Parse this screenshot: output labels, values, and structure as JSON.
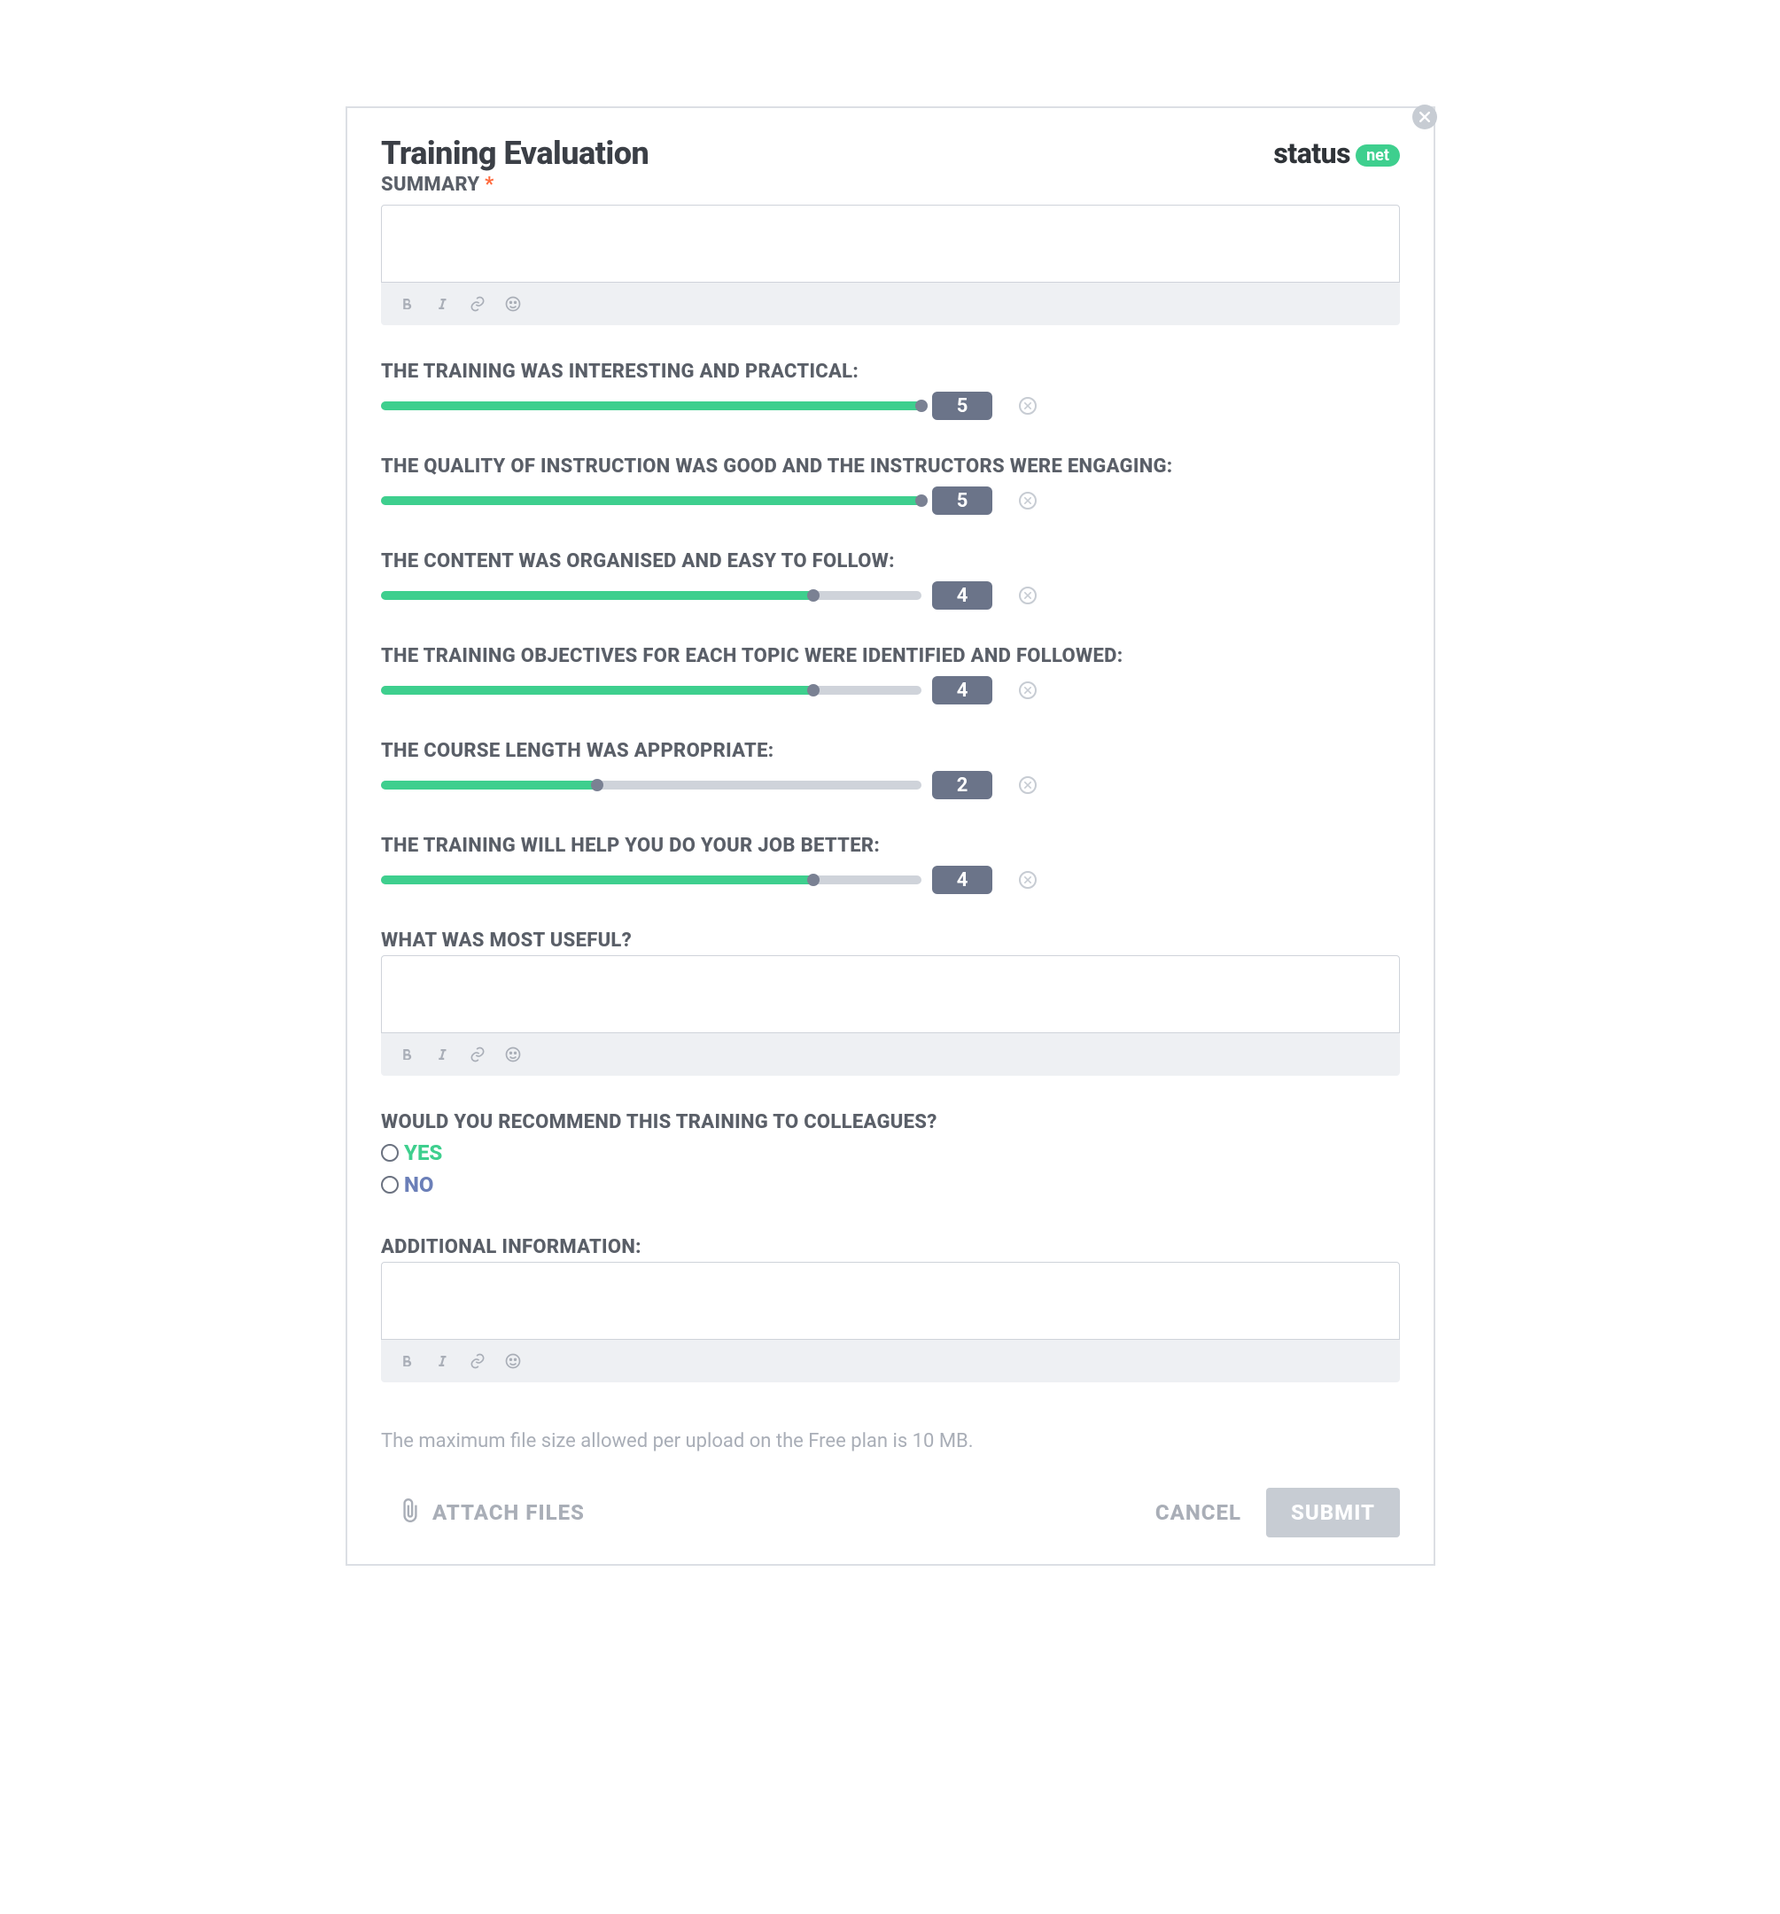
{
  "header": {
    "title": "Training Evaluation",
    "logo_text": "status",
    "logo_badge": "net"
  },
  "summary": {
    "label": "SUMMARY",
    "required": true,
    "value": ""
  },
  "ratings": [
    {
      "label": "THE TRAINING WAS INTERESTING AND PRACTICAL:",
      "value": 5,
      "max": 5
    },
    {
      "label": "THE QUALITY OF INSTRUCTION WAS GOOD AND THE INSTRUCTORS WERE ENGAGING:",
      "value": 5,
      "max": 5
    },
    {
      "label": "THE CONTENT WAS ORGANISED AND EASY TO FOLLOW:",
      "value": 4,
      "max": 5
    },
    {
      "label": "THE TRAINING OBJECTIVES FOR EACH TOPIC WERE IDENTIFIED AND FOLLOWED:",
      "value": 4,
      "max": 5
    },
    {
      "label": "THE COURSE LENGTH WAS APPROPRIATE:",
      "value": 2,
      "max": 5
    },
    {
      "label": "THE TRAINING WILL HELP YOU DO YOUR JOB BETTER:",
      "value": 4,
      "max": 5
    }
  ],
  "useful": {
    "label": "WHAT WAS MOST USEFUL?",
    "value": ""
  },
  "recommend": {
    "label": "WOULD YOU RECOMMEND THIS TRAINING TO COLLEAGUES?",
    "options": {
      "yes": "YES",
      "no": "NO"
    },
    "selected": null
  },
  "additional": {
    "label": "ADDITIONAL INFORMATION:",
    "value": ""
  },
  "file_note": "The maximum file size allowed per upload on the Free plan is 10 MB.",
  "footer": {
    "attach": "ATTACH FILES",
    "cancel": "CANCEL",
    "submit": "SUBMIT"
  }
}
